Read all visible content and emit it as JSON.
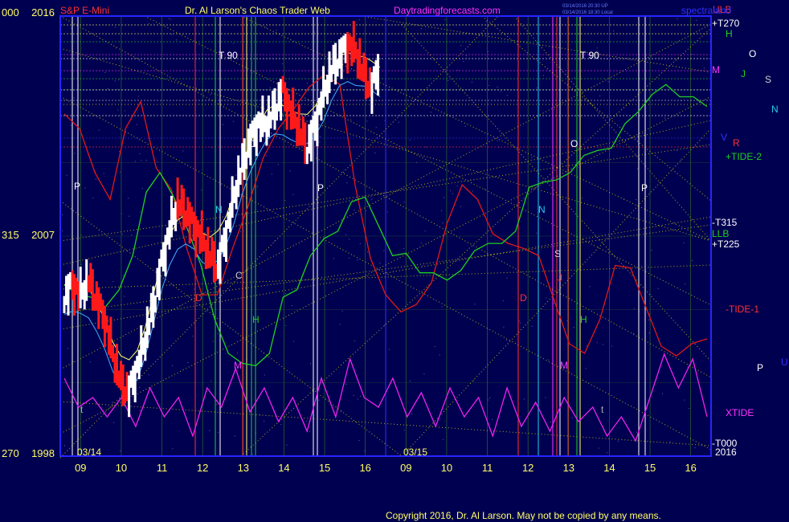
{
  "header": {
    "instrument": "S&P E-Mini",
    "title": "Dr. Al Larson's Chaos Trader Web",
    "site": "Daytradingforecasts.com",
    "stamp1": "03/14/2016 20:30 UP",
    "stamp2": "03/14/2016 18:30 Local",
    "corner": "spectraland"
  },
  "footer": {
    "copyright": "Copyright 2016, Dr. Al Larson. May not be copied by any means."
  },
  "colors": {
    "background": "#000050",
    "frame": "#2626ff",
    "grid": "#2a6a2a",
    "price_up": "#ffffff",
    "price_down": "#ff1a1a",
    "tide1": "#e01818",
    "tide2": "#20d020",
    "xtide": "#ee22ee",
    "dotted": "#e6e600",
    "envelope": "#40b0ff"
  },
  "chart_data": {
    "type": "line",
    "x_ticks": [
      "09",
      "10",
      "11",
      "12",
      "13",
      "14",
      "15",
      "16",
      "09",
      "10",
      "11",
      "12",
      "13",
      "14",
      "15",
      "16"
    ],
    "date_labels": [
      "03/14",
      "03/15"
    ],
    "left_axis": [
      {
        "left": "000",
        "right": "2016"
      },
      {
        "left": "315",
        "right": "2007"
      },
      {
        "left": "270",
        "right": "1998"
      }
    ],
    "right_labels": [
      {
        "text": "ULB",
        "color": "#ff3030"
      },
      {
        "text": "+T270",
        "color": "#ffffff"
      },
      {
        "text": "H",
        "color": "#20d020"
      },
      {
        "text": "O",
        "color": "#ffffff"
      },
      {
        "text": "M",
        "color": "#ff33ff"
      },
      {
        "text": "J",
        "color": "#20d020"
      },
      {
        "text": "S",
        "color": "#cfcfcf"
      },
      {
        "text": "N",
        "color": "#22ccee"
      },
      {
        "text": "V",
        "color": "#3030ff"
      },
      {
        "text": "R",
        "color": "#ff3030"
      },
      {
        "text": "+TIDE-2",
        "color": "#20d020"
      },
      {
        "text": "-T315",
        "color": "#ffffff"
      },
      {
        "text": "LLB",
        "color": "#20d020"
      },
      {
        "text": "+T225",
        "color": "#ffffff"
      },
      {
        "text": "-TIDE-1",
        "color": "#ff3030"
      },
      {
        "text": "U",
        "color": "#3030ff"
      },
      {
        "text": "P",
        "color": "#ffffff"
      },
      {
        "text": "XTIDE",
        "color": "#ff33ff"
      },
      {
        "text": "-T000",
        "color": "#ffffff"
      },
      {
        "text": "2016",
        "color": "#ffffff"
      }
    ],
    "annotations": [
      "P",
      "N",
      "O",
      "P",
      "P",
      "T 90",
      "T 90",
      "N",
      "O",
      "S",
      "J",
      "H",
      "M",
      "M",
      "t",
      "t",
      "D",
      "D",
      "C",
      "H"
    ],
    "price": [
      2004.5,
      2005,
      2004.6,
      2005.2,
      2004.4,
      2003.6,
      2002.2,
      2001,
      2000.6,
      2001.6,
      2002.8,
      2004.1,
      2005.8,
      2007.2,
      2008.4,
      2008,
      2007.4,
      2006.9,
      2006.2,
      2005.7,
      2007.1,
      2008.7,
      2009.9,
      2010.9,
      2011.6,
      2011.6,
      2012.2,
      2012.9,
      2012.1,
      2011.4,
      2010.6,
      2011.5,
      2012.8,
      2013.8,
      2014.3,
      2014.8,
      2014.6,
      2013.6,
      2013,
      2014.2
    ],
    "tide1": [
      2012,
      2011.4,
      2009.6,
      2008.5,
      2011.4,
      2012.5,
      2009.8,
      2008.9,
      2006.5,
      2004.6,
      2004.6,
      2006.5,
      2008.2,
      2010.2,
      2011.4,
      2012.2,
      2013.1,
      2013.6,
      2013.2,
      2009.1,
      2006.1,
      2004.6,
      2003.9,
      2004.2,
      2005.1,
      2007.5,
      2009.1,
      2008.5,
      2007.1,
      2006.7,
      2006.5,
      2006.2,
      2004.4,
      2002.6,
      2002.2,
      2003.6,
      2005.8,
      2005.7,
      2004.1,
      2002.5,
      2002.1,
      2002.6,
      2002.8
    ],
    "tide2": [
      2005,
      2004.6,
      2004.5,
      2004.1,
      2004.8,
      2006.2,
      2008.8,
      2009.6,
      2008.6,
      2007.3,
      2005.8,
      2003.6,
      2002.2,
      2001.8,
      2001.7,
      2002.2,
      2004.5,
      2004.8,
      2006.2,
      2006.9,
      2007.2,
      2008.4,
      2008.6,
      2007.4,
      2006.2,
      2006.3,
      2005.5,
      2005.5,
      2005.2,
      2005.6,
      2006.4,
      2006.7,
      2006.7,
      2007.2,
      2009,
      2009.2,
      2009.3,
      2009.6,
      2010.3,
      2010.5,
      2010.6,
      2011.6,
      2012.1,
      2012.8,
      2013.2,
      2012.7,
      2012.7,
      2012.3
    ],
    "xtide": [
      0.7,
      0.4,
      0.5,
      0.3,
      0.5,
      0.2,
      0.6,
      0.3,
      0.5,
      0.1,
      0.6,
      0.4,
      0.8,
      0.35,
      0.6,
      0.25,
      0.5,
      0.15,
      0.7,
      0.3,
      0.9,
      0.5,
      0.4,
      0.7,
      0.3,
      0.55,
      0.2,
      0.6,
      0.3,
      0.5,
      0.1,
      0.6,
      0.2,
      0.45,
      0.15,
      0.5,
      0.25,
      0.4,
      0.1,
      0.3,
      0.05,
      0.5,
      0.95,
      0.6,
      0.9,
      0.3
    ],
    "ylim": [
      1998,
      2016
    ]
  }
}
